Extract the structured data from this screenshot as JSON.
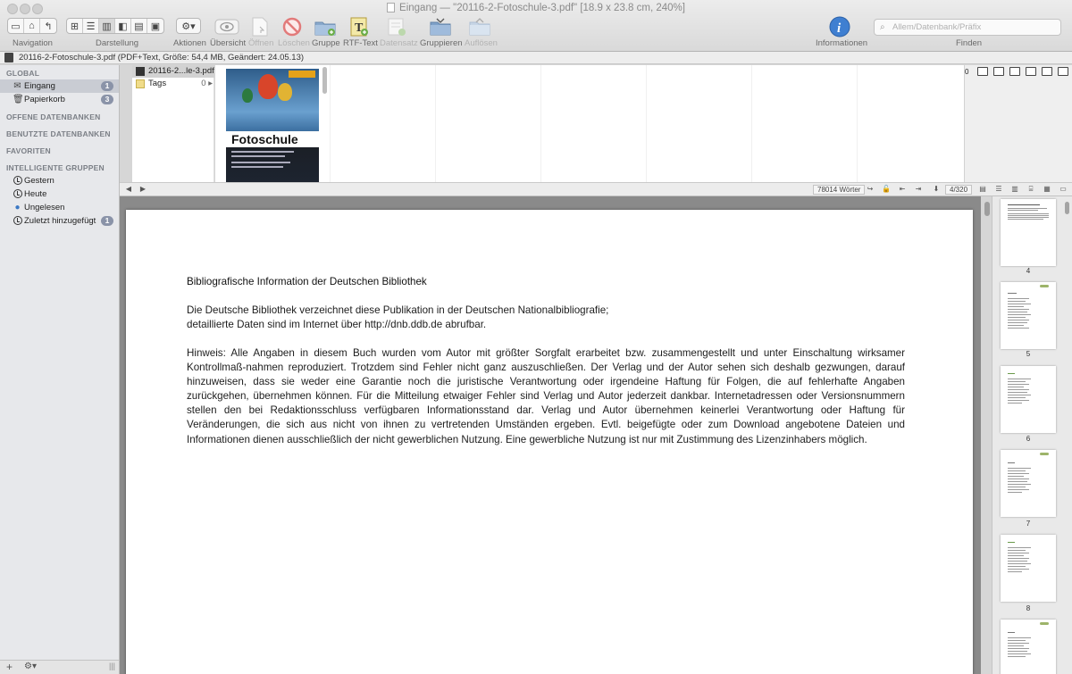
{
  "window": {
    "title": "Eingang — \"20116-2-Fotoschule-3.pdf\" [18.9 x 23.8 cm, 240%]"
  },
  "toolbar": {
    "navigation": "Navigation",
    "darstellung": "Darstellung",
    "aktionen": "Aktionen",
    "uebersicht": "Übersicht",
    "oeffnen": "Öffnen",
    "loeschen": "Löschen",
    "gruppe": "Gruppe",
    "rtf_text": "RTF-Text",
    "datensatz": "Datensatz",
    "gruppieren": "Gruppieren",
    "aufloesen": "Auflösen",
    "informationen": "Informationen",
    "finden": "Finden",
    "search_placeholder": "Allem/Datenbank/Präfix"
  },
  "pathbar": {
    "text": "20116-2-Fotoschule-3.pdf (PDF+Text, Größe: 54,4 MB, Geändert: 24.05.13)"
  },
  "sidebar": {
    "global_header": "GLOBAL",
    "items": [
      {
        "label": "Eingang",
        "badge": "1"
      },
      {
        "label": "Papierkorb",
        "badge": "3"
      }
    ],
    "offene_header": "OFFENE DATENBANKEN",
    "benutzte_header": "BENUTZTE DATENBANKEN",
    "favoriten_header": "FAVORITEN",
    "intelligente_header": "INTELLIGENTE GRUPPEN",
    "smart_groups": [
      {
        "label": "Gestern"
      },
      {
        "label": "Heute"
      },
      {
        "label": "Ungelesen"
      },
      {
        "label": "Zuletzt hinzugefügt",
        "badge": "1"
      }
    ]
  },
  "filelist": {
    "rows": [
      {
        "label": "20116-2...le-3.pdf"
      },
      {
        "label": "Tags",
        "count": "0"
      }
    ]
  },
  "cover": {
    "title": "Fotoschule"
  },
  "right_panel": {
    "count": "0"
  },
  "doc_toolbar": {
    "word_count": "78014 Wörter",
    "page_indicator": "4/320"
  },
  "document": {
    "heading": "Bibliografische Information der Deutschen Bibliothek",
    "para1_line1": "Die Deutsche Bibliothek verzeichnet diese Publikation in der Deutschen Nationalbibliografie;",
    "para1_line2": "detaillierte Daten sind im Internet über http://dnb.ddb.de abrufbar.",
    "para2": "Hinweis: Alle Angaben in diesem Buch wurden vom Autor mit größter Sorgfalt erarbeitet bzw. zusammengestellt und unter Einschaltung wirksamer Kontrollmaß-nahmen reproduziert. Trotzdem sind Fehler nicht ganz auszuschließen. Der Verlag und der Autor sehen sich deshalb gezwungen, darauf hinzuweisen, dass sie weder eine Garantie noch die juristische Verantwortung oder irgendeine Haftung für Folgen, die auf fehlerhafte Angaben zurückgehen, übernehmen können. Für die Mitteilung etwaiger Fehler sind Verlag und Autor jederzeit dankbar. Internetadressen oder Versionsnummern stellen den bei Redaktionsschluss verfügbaren Informationsstand dar. Verlag und Autor übernehmen keinerlei Verantwortung oder Haftung für Veränderungen, die sich aus nicht von ihnen zu vertretenden Umständen ergeben. Evtl. beigefügte oder zum Download angebotene Dateien und Informationen dienen ausschließlich der nicht gewerblichen Nutzung. Eine gewerbliche Nutzung ist nur mit Zustimmung des Lizenzinhabers möglich."
  },
  "thumbnails": [
    {
      "page": "4"
    },
    {
      "page": "5"
    },
    {
      "page": "6"
    },
    {
      "page": "7"
    },
    {
      "page": "8"
    }
  ]
}
